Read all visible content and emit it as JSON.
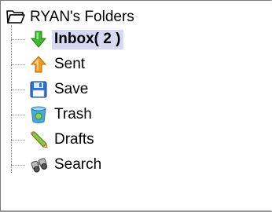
{
  "tree": {
    "root_label": "RYAN's Folders",
    "items": [
      {
        "label": "Inbox( 2 )",
        "icon": "inbox-arrow-icon"
      },
      {
        "label": "Sent",
        "icon": "sent-arrow-icon"
      },
      {
        "label": "Save",
        "icon": "save-disk-icon"
      },
      {
        "label": "Trash",
        "icon": "trash-bin-icon"
      },
      {
        "label": "Drafts",
        "icon": "drafts-pencil-icon"
      },
      {
        "label": "Search",
        "icon": "search-binoculars-icon"
      }
    ],
    "selected": "Inbox( 2 )"
  },
  "colors": {
    "selection_bg": "#d6d8f4",
    "inbox_arrow": "#3dbb2c",
    "sent_arrow": "#f39a1d",
    "save_disk": "#2f6fd0",
    "trash_bin": "#4aa8e0",
    "drafts_pencil": "#8cc63f"
  }
}
